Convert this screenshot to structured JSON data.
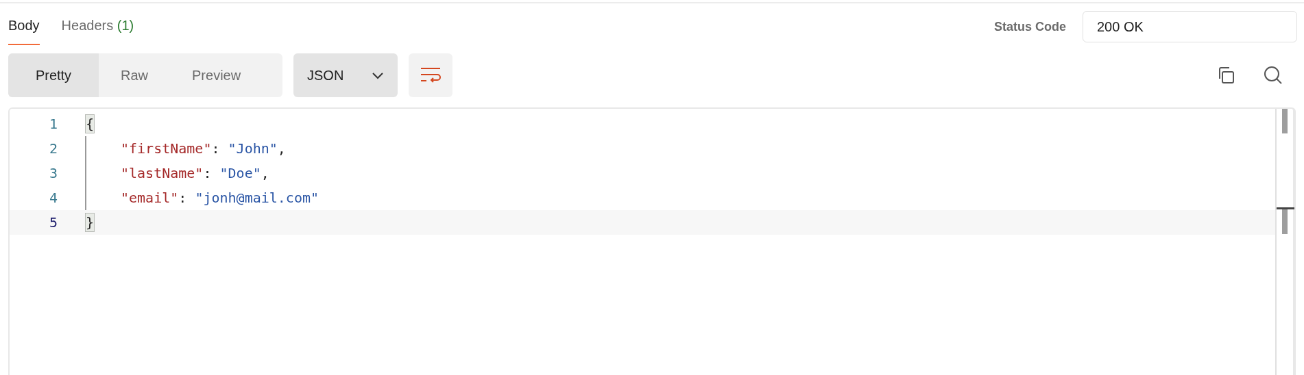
{
  "tabs": [
    {
      "label": "Body",
      "selected": true
    },
    {
      "label": "Headers",
      "count": "(1)",
      "selected": false
    }
  ],
  "status": {
    "label": "Status Code",
    "value": "200 OK"
  },
  "view_modes": [
    {
      "label": "Pretty",
      "selected": true
    },
    {
      "label": "Raw",
      "selected": false
    },
    {
      "label": "Preview",
      "selected": false
    }
  ],
  "format": {
    "value": "JSON"
  },
  "editor": {
    "lines": [
      {
        "number": "1",
        "active": false,
        "indent": false,
        "tokens": [
          {
            "kind": "brace",
            "text": "{"
          }
        ]
      },
      {
        "number": "2",
        "active": false,
        "indent": true,
        "tokens": [
          {
            "kind": "key",
            "text": "\"firstName\""
          },
          {
            "kind": "punct",
            "text": ": "
          },
          {
            "kind": "string",
            "text": "\"John\""
          },
          {
            "kind": "punct",
            "text": ","
          }
        ]
      },
      {
        "number": "3",
        "active": false,
        "indent": true,
        "tokens": [
          {
            "kind": "key",
            "text": "\"lastName\""
          },
          {
            "kind": "punct",
            "text": ": "
          },
          {
            "kind": "string",
            "text": "\"Doe\""
          },
          {
            "kind": "punct",
            "text": ","
          }
        ]
      },
      {
        "number": "4",
        "active": false,
        "indent": true,
        "tokens": [
          {
            "kind": "key",
            "text": "\"email\""
          },
          {
            "kind": "punct",
            "text": ": "
          },
          {
            "kind": "string",
            "text": "\"jonh@mail.com\""
          }
        ]
      },
      {
        "number": "5",
        "active": true,
        "indent": false,
        "tokens": [
          {
            "kind": "brace",
            "text": "}"
          }
        ]
      }
    ]
  }
}
